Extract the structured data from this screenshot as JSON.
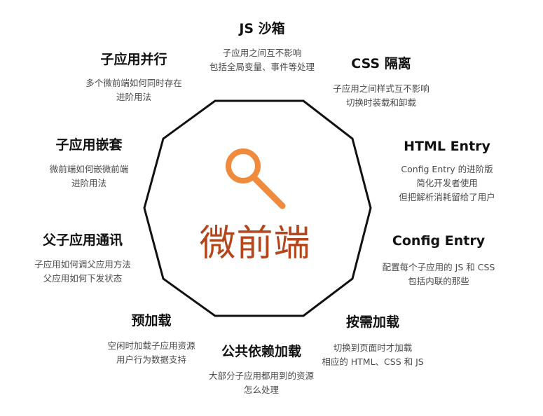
{
  "center": {
    "title": "微前端",
    "icon": "search-icon",
    "accent": "#F08A3C",
    "title_color": "#B5451B"
  },
  "features": [
    {
      "title": "JS 沙箱",
      "lines": [
        "子应用之间互不影响",
        "包括全局变量、事件等处理"
      ]
    },
    {
      "title": "CSS 隔离",
      "lines": [
        "子应用之间样式互不影响",
        "切换时装载和卸载"
      ]
    },
    {
      "title": "HTML Entry",
      "lines": [
        "Config Entry 的进阶版",
        "简化开发者使用",
        "但把解析消耗留给了用户"
      ]
    },
    {
      "title": "Config Entry",
      "lines": [
        "配置每个子应用的 JS 和 CSS",
        "包括内联的那些"
      ]
    },
    {
      "title": "按需加载",
      "lines": [
        "切换到页面时才加载",
        "相应的 HTML、CSS 和 JS"
      ]
    },
    {
      "title": "公共依赖加载",
      "lines": [
        "大部分子应用都用到的资源",
        "怎么处理"
      ]
    },
    {
      "title": "预加载",
      "lines": [
        "空闲时加载子应用资源",
        "用户行为数据支持"
      ]
    },
    {
      "title": "父子应用通讯",
      "lines": [
        "子应用如何调父应用方法",
        "父应用如何下发状态"
      ]
    },
    {
      "title": "子应用嵌套",
      "lines": [
        "微前端如何嵌微前端",
        "进阶用法"
      ]
    },
    {
      "title": "子应用并行",
      "lines": [
        "多个微前端如何同时存在",
        "进阶用法"
      ]
    }
  ]
}
